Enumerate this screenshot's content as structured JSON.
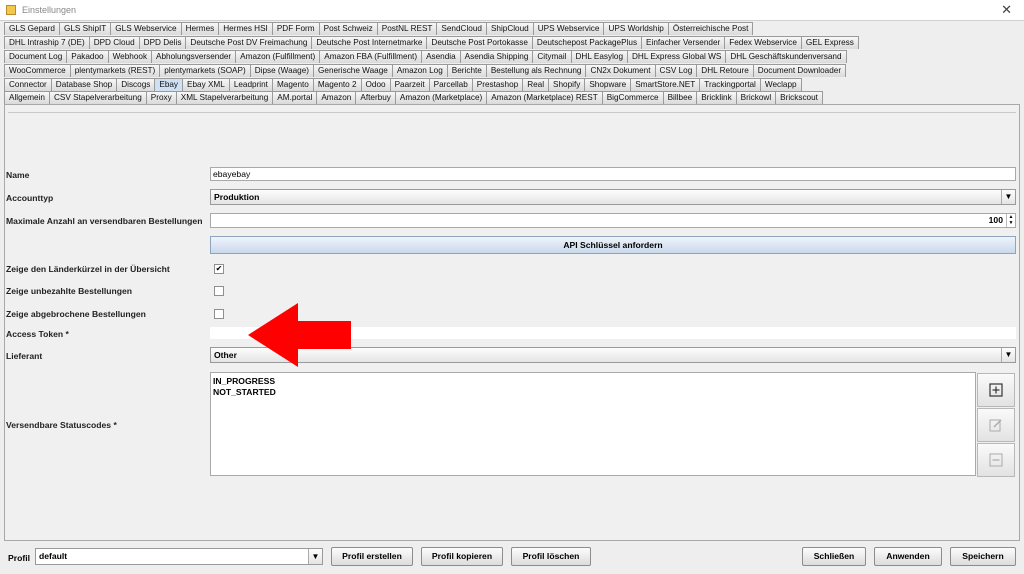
{
  "window": {
    "title": "Einstellungen",
    "close_glyph": "✕"
  },
  "tab_rows": [
    [
      "GLS Gepard",
      "GLS ShipIT",
      "GLS Webservice",
      "Hermes",
      "Hermes HSI",
      "PDF Form",
      "Post Schweiz",
      "PostNL REST",
      "SendCloud",
      "ShipCloud",
      "UPS Webservice",
      "UPS Worldship",
      "Österreichische Post"
    ],
    [
      "DHL Intraship 7 (DE)",
      "DPD Cloud",
      "DPD Delis",
      "Deutsche Post DV Freimachung",
      "Deutsche Post Internetmarke",
      "Deutsche Post Portokasse",
      "Deutschepost PackagePlus",
      "Einfacher Versender",
      "Fedex Webservice",
      "GEL Express"
    ],
    [
      "Document Log",
      "Pakadoo",
      "Webhook",
      "Abholungsversender",
      "Amazon (Fulfillment)",
      "Amazon FBA (Fulfillment)",
      "Asendia",
      "Asendia Shipping",
      "Citymail",
      "DHL Easylog",
      "DHL Express Global WS",
      "DHL Geschäftskundenversand"
    ],
    [
      "WooCommerce",
      "plentymarkets (REST)",
      "plentymarkets (SOAP)",
      "Dipse (Waage)",
      "Generische Waage",
      "Amazon Log",
      "Berichte",
      "Bestellung als Rechnung",
      "CN2x Dokument",
      "CSV Log",
      "DHL Retoure",
      "Document Downloader"
    ],
    [
      "Connector",
      "Database Shop",
      "Discogs",
      "Ebay",
      "Ebay XML",
      "Leadprint",
      "Magento",
      "Magento 2",
      "Odoo",
      "Paarzeit",
      "Parcellab",
      "Prestashop",
      "Real",
      "Shopify",
      "Shopware",
      "SmartStore.NET",
      "Trackingportal",
      "Weclapp"
    ],
    [
      "Allgemein",
      "CSV Stapelverarbeitung",
      "Proxy",
      "XML Stapelverarbeitung",
      "AM.portal",
      "Amazon",
      "Afterbuy",
      "Amazon (Marketplace)",
      "Amazon (Marketplace) REST",
      "BigCommerce",
      "Billbee",
      "Bricklink",
      "Brickowl",
      "Brickscout"
    ]
  ],
  "active_tab": "Ebay",
  "form": {
    "name_label": "Name",
    "name_value": "ebayebay",
    "accounttyp_label": "Accounttyp",
    "accounttyp_value": "Produktion",
    "max_label": "Maximale Anzahl an versendbaren Bestellungen",
    "max_value": "100",
    "api_button": "API Schlüssel anfordern",
    "cb1_label": "Zeige den Länderkürzel in der Übersicht",
    "cb1_checked": true,
    "cb2_label": "Zeige unbezahlte Bestellungen",
    "cb2_checked": false,
    "cb3_label": "Zeige abgebrochene Bestellungen",
    "cb3_checked": false,
    "token_label": "Access Token *",
    "token_value": "",
    "lieferant_label": "Lieferant",
    "lieferant_value": "Other",
    "status_label": "Versendbare Statuscodes *",
    "status_items": [
      "IN_PROGRESS",
      "NOT_STARTED"
    ],
    "checkmark_glyph": "✔",
    "dropdown_glyph": "▼",
    "spin_up_glyph": "▲",
    "spin_down_glyph": "▼"
  },
  "icons": {
    "add": "add-icon",
    "edit": "edit-icon",
    "remove": "remove-icon",
    "annotation": "red-arrow-left"
  },
  "colors": {
    "annotation_red": "#ff0000",
    "active_tab": "#cfe0f3",
    "api_button": "#c9d9ec"
  },
  "bottom": {
    "profil_label": "Profil",
    "profil_value": "default",
    "btn_erstellen": "Profil erstellen",
    "btn_kopieren": "Profil kopieren",
    "btn_loeschen": "Profil löschen",
    "btn_schliessen": "Schließen",
    "btn_anwenden": "Anwenden",
    "btn_speichern": "Speichern"
  }
}
